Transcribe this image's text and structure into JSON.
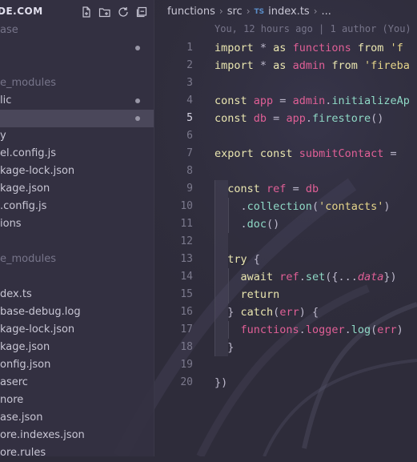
{
  "sidebar": {
    "title": "DE.COM",
    "actions": [
      "new-file-icon",
      "new-folder-icon",
      "refresh-icon",
      "collapse-all-icon"
    ],
    "items": [
      {
        "label": "ase",
        "color": "#77758a",
        "dot": false
      },
      {
        "label": "",
        "color": "#c8c6d4",
        "dot": true
      },
      {
        "label": "",
        "color": "#c8c6d4",
        "dot": false
      },
      {
        "label": "e_modules",
        "color": "#77758a",
        "dot": false
      },
      {
        "label": "lic",
        "color": "#c8c6d4",
        "dot": true
      },
      {
        "label": "",
        "color": "#c8c6d4",
        "dot": true,
        "selected": true
      },
      {
        "label": "y",
        "color": "#c8c6d4",
        "dot": false
      },
      {
        "label": "el.config.js",
        "color": "#c8c6d4",
        "dot": false
      },
      {
        "label": "kage-lock.json",
        "color": "#c8c6d4",
        "dot": false
      },
      {
        "label": "kage.json",
        "color": "#c8c6d4",
        "dot": false
      },
      {
        "label": ".config.js",
        "color": "#c8c6d4",
        "dot": false
      },
      {
        "label": "ions",
        "color": "#c8c6d4",
        "dot": false
      },
      {
        "label": "",
        "color": "#c8c6d4",
        "dot": false
      },
      {
        "label": "e_modules",
        "color": "#77758a",
        "dot": false
      },
      {
        "label": "",
        "color": "#c8c6d4",
        "dot": false
      },
      {
        "label": "dex.ts",
        "color": "#c8c6d4",
        "dot": false
      },
      {
        "label": "base-debug.log",
        "color": "#c8c6d4",
        "dot": false
      },
      {
        "label": "kage-lock.json",
        "color": "#c8c6d4",
        "dot": false
      },
      {
        "label": "kage.json",
        "color": "#c8c6d4",
        "dot": false
      },
      {
        "label": "onfig.json",
        "color": "#c8c6d4",
        "dot": false
      },
      {
        "label": "aserc",
        "color": "#c8c6d4",
        "dot": false
      },
      {
        "label": "nore",
        "color": "#c8c6d4",
        "dot": false
      },
      {
        "label": "ase.json",
        "color": "#c8c6d4",
        "dot": false
      },
      {
        "label": "ore.indexes.json",
        "color": "#c8c6d4",
        "dot": false
      },
      {
        "label": "ore.rules",
        "color": "#c8c6d4",
        "dot": false
      }
    ]
  },
  "editor": {
    "breadcrumb": [
      "functions",
      "src",
      "index.ts",
      "..."
    ],
    "ts_badge": "TS",
    "blame": "You, 12 hours ago | 1 author (You)",
    "active_line": 5,
    "lines": [
      {
        "n": "1",
        "tokens": [
          [
            "k",
            "import "
          ],
          [
            "o",
            "* "
          ],
          [
            "k",
            "as "
          ],
          [
            "p",
            "functions "
          ],
          [
            "k",
            "from "
          ],
          [
            "s",
            "'f"
          ]
        ]
      },
      {
        "n": "2",
        "tokens": [
          [
            "k",
            "import "
          ],
          [
            "o",
            "* "
          ],
          [
            "k",
            "as "
          ],
          [
            "p",
            "admin "
          ],
          [
            "k",
            "from "
          ],
          [
            "s",
            "'fireba"
          ]
        ]
      },
      {
        "n": "3",
        "tokens": []
      },
      {
        "n": "4",
        "tokens": [
          [
            "k",
            "const "
          ],
          [
            "p",
            "app "
          ],
          [
            "o",
            "= "
          ],
          [
            "p",
            "admin"
          ],
          [
            "o",
            "."
          ],
          [
            "f",
            "initializeAp"
          ]
        ]
      },
      {
        "n": "5",
        "tokens": [
          [
            "k",
            "const "
          ],
          [
            "p",
            "db "
          ],
          [
            "o",
            "= "
          ],
          [
            "p",
            "app"
          ],
          [
            "o",
            "."
          ],
          [
            "f",
            "firestore"
          ],
          [
            "o",
            "()"
          ]
        ]
      },
      {
        "n": "6",
        "tokens": []
      },
      {
        "n": "7",
        "tokens": [
          [
            "k",
            "export "
          ],
          [
            "k",
            "const "
          ],
          [
            "p",
            "submitContact "
          ],
          [
            "o",
            "= "
          ]
        ]
      },
      {
        "n": "8",
        "tokens": []
      },
      {
        "n": "9",
        "tokens": [
          [
            "w",
            "  "
          ],
          [
            "k",
            "const "
          ],
          [
            "p",
            "ref "
          ],
          [
            "o",
            "= "
          ],
          [
            "p",
            "db"
          ]
        ]
      },
      {
        "n": "10",
        "tokens": [
          [
            "w",
            "    "
          ],
          [
            "o",
            "."
          ],
          [
            "f",
            "collection"
          ],
          [
            "o",
            "("
          ],
          [
            "s",
            "'contacts'"
          ],
          [
            "o",
            ")"
          ]
        ]
      },
      {
        "n": "11",
        "tokens": [
          [
            "w",
            "    "
          ],
          [
            "o",
            "."
          ],
          [
            "f",
            "doc"
          ],
          [
            "o",
            "()"
          ]
        ]
      },
      {
        "n": "12",
        "tokens": []
      },
      {
        "n": "13",
        "tokens": [
          [
            "w",
            "  "
          ],
          [
            "k",
            "try "
          ],
          [
            "o",
            "{"
          ]
        ]
      },
      {
        "n": "14",
        "tokens": [
          [
            "w",
            "    "
          ],
          [
            "k",
            "await "
          ],
          [
            "p",
            "ref"
          ],
          [
            "o",
            "."
          ],
          [
            "f",
            "set"
          ],
          [
            "o",
            "({..."
          ],
          [
            "i",
            "data"
          ],
          [
            "o",
            "})"
          ]
        ]
      },
      {
        "n": "15",
        "tokens": [
          [
            "w",
            "    "
          ],
          [
            "k",
            "return"
          ]
        ]
      },
      {
        "n": "16",
        "tokens": [
          [
            "w",
            "  "
          ],
          [
            "o",
            "} "
          ],
          [
            "k",
            "catch"
          ],
          [
            "o",
            "("
          ],
          [
            "p",
            "err"
          ],
          [
            "o",
            ") {"
          ]
        ]
      },
      {
        "n": "17",
        "tokens": [
          [
            "w",
            "    "
          ],
          [
            "p",
            "functions"
          ],
          [
            "o",
            "."
          ],
          [
            "p",
            "logger"
          ],
          [
            "o",
            "."
          ],
          [
            "f",
            "log"
          ],
          [
            "o",
            "("
          ],
          [
            "p",
            "err"
          ],
          [
            "o",
            ")"
          ]
        ]
      },
      {
        "n": "18",
        "tokens": [
          [
            "w",
            "  "
          ],
          [
            "o",
            "}"
          ]
        ]
      },
      {
        "n": "19",
        "tokens": []
      },
      {
        "n": "20",
        "tokens": [
          [
            "o",
            "})"
          ]
        ]
      }
    ]
  }
}
